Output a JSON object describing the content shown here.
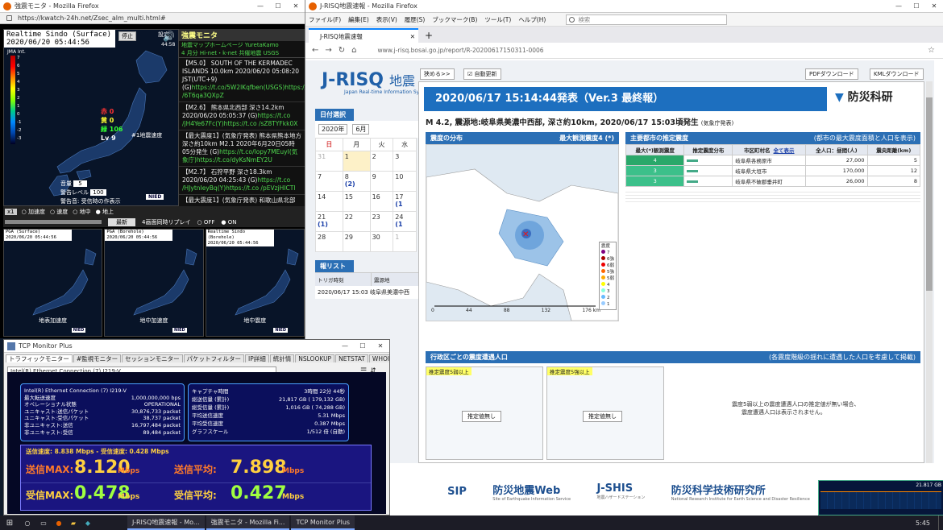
{
  "win1": {
    "title": "強震モニタ - Mozilla Firefox",
    "url": "https://kwatch-24h.net/Zsec_alm_multi.html#",
    "map_title": "Realtime Sindo (Surface)",
    "map_time": "2020/06/20 05:44:56",
    "stop_btn": "停止",
    "jma": "JMA Int.",
    "scale": [
      "7",
      "6",
      "5",
      "4",
      "3",
      "2",
      "1",
      "0",
      "-1",
      "-2",
      "-3"
    ],
    "counts": [
      {
        "label": "赤",
        "val": "0"
      },
      {
        "label": "黄",
        "val": "0"
      },
      {
        "label": "緑",
        "val": "106"
      },
      {
        "label": "Lv",
        "val": "9"
      }
    ],
    "eq_note": "#1地震速度",
    "setting_label": "音量",
    "setting_val": "5",
    "warn_label": "警告レベル",
    "warn_val": "100",
    "quake_reporting": "警告音: 受信時の作表示",
    "nied": "NIED",
    "tbar_speed": "x1",
    "radio_opts": [
      "加速度",
      "速度",
      "地中",
      "地上"
    ],
    "latest_btn": "最新",
    "replay_label": "4画面同時リプレイ",
    "off": "OFF",
    "on": "ON",
    "mini_maps": [
      {
        "t": "PGA (Surface)",
        "d": "2020/06/20 05:44:56",
        "cap": "地表加速度"
      },
      {
        "t": "PGA (Borehole)",
        "d": "2020/06/20 05:44:56",
        "cap": "地中加速度"
      },
      {
        "t": "Realtime Sindo (Borehole)",
        "d": "2020/06/20 05:44:56",
        "cap": "地中震度"
      }
    ],
    "side_time": "44:58",
    "side_label": "設定",
    "panel_title": "強震モニタ",
    "panel_sub1": "地震マップホームページ YuretaKamo",
    "panel_sub2": "4 月分 Hi-net・k-net 共催地震 USGS",
    "tweets": [
      {
        "head": "【M5.0】 SOUTH OF THE KERMADEC ISLANDS 10.0km 2020/06/20 05:08:20 JST(UTC+9) (G)",
        "link": "https://t.co/5W2lKqfben",
        "tail": "(USGS)https://t.co /6T6qa3QXpZ"
      },
      {
        "head": "【M2.6】 熊本県北西部 深さ14.2km 2020/06/20 05:05:37 (G)",
        "link": "https://t.co /jH4Ye67Fc",
        "tail": "(Y)https://t.co /sZ8TYFkk0X"
      },
      {
        "head": "【最大震度1】(気象庁発表) 熊本県熊本地方 深さ約10km M2.1 2020年6月20日05時05分発生 (G)",
        "link": "https://t.co/lopy7MEuyI",
        "tail": "(気象庁)https://t.co/dyKsNmEY2U"
      },
      {
        "head": "【M2.7】 石狩平野 深さ18.3km 2020/06/20 04:25:43 (G)",
        "link": "https://t.co /HJytnIeyBq",
        "tail": "(Y)https://t.co /pEVzjHICTI"
      },
      {
        "head": "【最大震度1】(気象庁発表) 和歌山県北部",
        "link": "",
        "tail": ""
      }
    ]
  },
  "win2": {
    "title": "J-RISQ地震速報 - Mozilla Firefox",
    "menu": [
      "ファイル(F)",
      "編集(E)",
      "表示(V)",
      "履歴(S)",
      "ブックマーク(B)",
      "ツール(T)",
      "ヘルプ(H)"
    ],
    "search_ph": "検索",
    "tab_label": "J-RISQ地震速報",
    "url": "www.j-risq.bosai.go.jp/report/R-20200617150311-0006",
    "btn_collapse": "狭める>>",
    "chk_auto": "自動更新",
    "btn_pdf": "PDFダウンロード",
    "btn_kml": "KMLダウンロード",
    "logo_sub": "Japan Real-time Information Sy",
    "date_header": "日付選択",
    "year": "2020年",
    "month": "6月",
    "weekdays": [
      "日",
      "月",
      "火",
      "水"
    ],
    "cal": [
      [
        "31",
        "1",
        "2",
        "3"
      ],
      [
        "7",
        "8",
        "9",
        "10"
      ],
      [
        "14",
        "15",
        "16",
        "17"
      ],
      [
        "21",
        "22",
        "23",
        "24"
      ],
      [
        "28",
        "29",
        "30",
        "1"
      ]
    ],
    "cal_badges": [
      {
        "r": 1,
        "c": 1,
        "t": "(2)"
      },
      {
        "r": 2,
        "c": 3,
        "t": "(1"
      },
      {
        "r": 3,
        "c": 0,
        "t": "(1)"
      },
      {
        "r": 3,
        "c": 3,
        "t": "(1"
      }
    ],
    "report_list": "報リスト",
    "rl_col1": "トリガ時刻",
    "rl_col2": "震源地",
    "rl_row_time": "2020/06/17 15:03",
    "rl_row_place": "岐阜県美濃中西",
    "report_title": "2020/06/17 15:14:44発表（Ver.3 最終報）",
    "org": "防災科研",
    "subhead": "M 4.2, 震源地:岐阜県美濃中西部, 深さ約10km, 2020/06/17 15:03頃発生",
    "subhead_src": "(気象庁発表)",
    "dist_title": "震度の分布",
    "dist_max": "最大観測震度4 (*)",
    "est_title": "主要都市の推定震度",
    "est_note": "(都市の最大震度面積と人口を表示)",
    "est_cols": [
      "最大(*)観測震度",
      "推定震度分布",
      "市区町村名",
      "全人口：昼間(人)",
      "震央距離(km)"
    ],
    "show_all": "全て表示",
    "est_rows": [
      {
        "sindo": "4",
        "city": "岐阜県各務原市",
        "pop": "27,000",
        "dist": "5"
      },
      {
        "sindo": "3",
        "city": "岐阜県大垣市",
        "pop": "170,000",
        "dist": "12"
      },
      {
        "sindo": "3",
        "city": "岐阜県不破郡垂井町",
        "pop": "26,000",
        "dist": "8"
      }
    ],
    "scale_ticks": [
      "0",
      "44",
      "88",
      "132",
      "176 km"
    ],
    "legend_title": "震度",
    "legend": [
      "7",
      "6強",
      "6弱",
      "5強",
      "5弱",
      "4",
      "3",
      "2",
      "1"
    ],
    "pop_title": "行政区ごとの震度遭遇人口",
    "pop_note": "(各震度階級の揺れに遭遇した人口を考慮して掲載)",
    "pop_tag1": "推定震度5弱以上",
    "pop_tag2": "推定震度5強以上",
    "pop_btn": "推定値無し",
    "pop_msg1": "震度5弱以上の震度遭遇人口の推定値が無い場合、",
    "pop_msg2": "震度遭遇人口は表示されません。",
    "footer": [
      {
        "n": "SIP"
      },
      {
        "n": "防災地震Web",
        "s": "Site of Earthquake Information Service"
      },
      {
        "n": "J-SHIS",
        "s": "地震ハザードステーション"
      },
      {
        "n": "防災科学技術研究所",
        "s": "National Research Institute for Earth Science and Disaster Resilience"
      }
    ],
    "mini_graph": "21.817 GB"
  },
  "win3": {
    "title": "TCP Monitor Plus",
    "tabs": [
      "トラフィックモニター",
      "#監視モニター",
      "セッションモニター",
      "パケットフィルター",
      "IP詳細",
      "統計情",
      "NSLOOKUP",
      "NETSTAT",
      "WHOIS",
      "PING",
      "TRA"
    ],
    "adapter": "Intel(R) Ethernet Connection (7) I219-V",
    "left_box": [
      [
        "Intel(R) Ethernet Connection (7) I219-V",
        ""
      ],
      [
        "最大転送速度",
        "1,000,000,000 bps"
      ],
      [
        "オペレーショナル状態",
        "OPERATIONAL"
      ],
      [
        "ユニキャスト:送信パケット",
        "30,876,733 packet"
      ],
      [
        "ユニキャスト:受信パケット",
        "38,737 packet"
      ],
      [
        "非ユニキャスト:送信",
        "16,797,484 packet"
      ],
      [
        "非ユニキャスト:受信",
        "89,484 packet"
      ]
    ],
    "right_box": [
      [
        "キャプチャ時間",
        "3時間 22分 44秒"
      ],
      [
        "総送信量 (累計)",
        "21,817 GB ( 179,132 GB)"
      ],
      [
        "総受信量 (累計)",
        "1,016 GB ( 74,288 GB)"
      ],
      [
        "平均送信速度",
        "5.31 Mbps"
      ],
      [
        "平均受信速度",
        "0.387 Mbps"
      ],
      [
        "グラフスケール",
        "1/512 倍 (自動)"
      ]
    ],
    "speed_line": "送信速度: 8.838 Mbps - 受信速度: 0.428 Mbps",
    "tx_max_label": "送信MAX:",
    "tx_max": "8.120",
    "tx_avg_label": "送信平均:",
    "tx_avg": "7.898",
    "rx_max_label": "受信MAX:",
    "rx_max": "0.478",
    "rx_avg_label": "受信平均:",
    "rx_avg": "0.427",
    "unit": "Mbps"
  },
  "taskbar": {
    "tasks": [
      "J-RISQ地震速報 - Mo...",
      "強震モニタ - Mozilla Fi...",
      "TCP Monitor Plus"
    ],
    "time": "5:45"
  }
}
